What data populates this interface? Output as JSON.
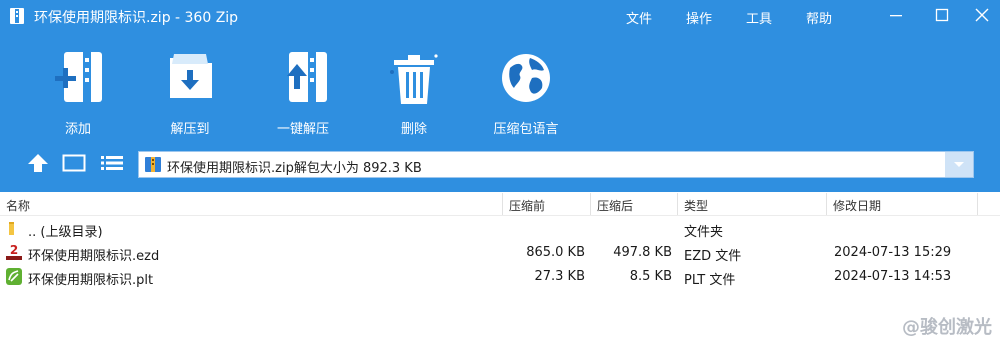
{
  "window": {
    "title": "环保使用期限标识.zip - 360 Zip",
    "menu": [
      "文件",
      "操作",
      "工具",
      "帮助"
    ]
  },
  "toolbar": {
    "buttons": [
      {
        "label": "添加",
        "icon": "add-icon"
      },
      {
        "label": "解压到",
        "icon": "extract-to-icon"
      },
      {
        "label": "一键解压",
        "icon": "one-click-extract-icon"
      },
      {
        "label": "删除",
        "icon": "delete-icon"
      },
      {
        "label": "压缩包语言",
        "icon": "globe-icon"
      }
    ]
  },
  "address": {
    "text": "环保使用期限标识.zip解包大小为 892.3 KB"
  },
  "columns": {
    "name": "名称",
    "compressed_before": "压缩前",
    "compressed_after": "压缩后",
    "type": "类型",
    "modified": "修改日期"
  },
  "rows": [
    {
      "name": ".. (上级目录)",
      "before": "",
      "after": "",
      "type": "文件夹",
      "modified": "",
      "icon": "folder-icon"
    },
    {
      "name": "环保使用期限标识.ezd",
      "before": "865.0 KB",
      "after": "497.8 KB",
      "type": "EZD 文件",
      "modified": "2024-07-13 15:29",
      "icon": "ezcad-file-icon"
    },
    {
      "name": "环保使用期限标识.plt",
      "before": "27.3 KB",
      "after": "8.5 KB",
      "type": "PLT 文件",
      "modified": "2024-07-13 14:53",
      "icon": "plt-file-icon"
    }
  ],
  "watermark": "@骏创激光",
  "colors": {
    "toolbar_bg": "#2f8fe0",
    "accent": "#1e6fc0"
  }
}
